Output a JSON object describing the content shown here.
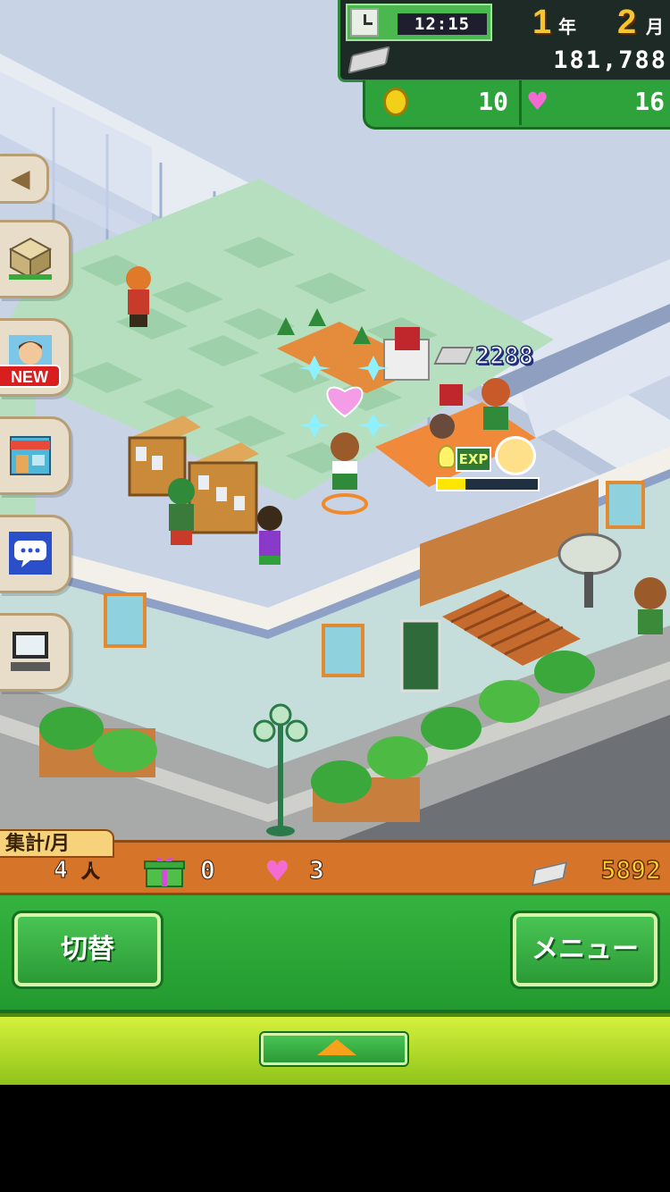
{
  "hud": {
    "time": "12:15",
    "year_num": "1",
    "year_label": "年",
    "month_num": "2",
    "month_label": "月",
    "money": "181,788",
    "coins": "10",
    "hearts": "16",
    "money_icon": "money-bill-icon",
    "coin_icon": "gold-coin-icon",
    "heart_icon": "heart-icon"
  },
  "side_menu": {
    "back_icon": "chevron-left-icon",
    "items": [
      {
        "name": "build-item",
        "icon": "crate-icon"
      },
      {
        "name": "staff",
        "icon": "staff-portrait-icon",
        "badge": "NEW"
      },
      {
        "name": "shop",
        "icon": "storefront-icon"
      },
      {
        "name": "messages",
        "icon": "speech-bubble-icon"
      },
      {
        "name": "computer",
        "icon": "computer-icon"
      }
    ]
  },
  "floating": {
    "price": "2288",
    "exp_label": "EXP",
    "exp_progress": 0.28
  },
  "status_strip": {
    "tab_label": "集計/月",
    "visitors": "4",
    "visitors_unit": "人",
    "gifts": "0",
    "hearts": "3",
    "money": "5892"
  },
  "controls": {
    "switch_label": "切替",
    "menu_label": "メニュー",
    "expand_icon": "triangle-up-icon"
  },
  "colors": {
    "hud_green": "#2ea33b",
    "strip_orange": "#d6742a",
    "accent_yellow": "#f7c62b"
  }
}
